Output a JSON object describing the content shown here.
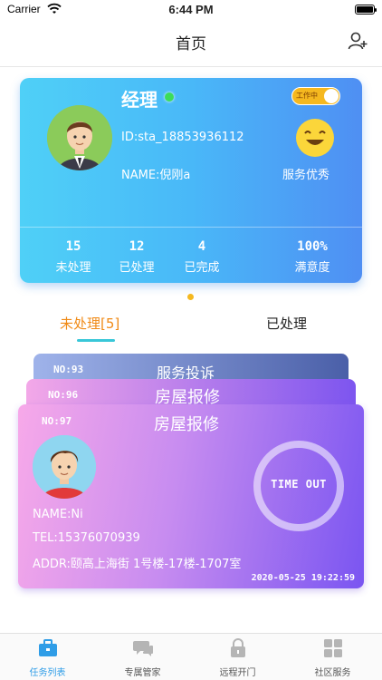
{
  "status_bar": {
    "carrier": "Carrier",
    "time": "6:44 PM"
  },
  "nav": {
    "title": "首页",
    "add_icon": "add-user-icon"
  },
  "profile": {
    "role": "经理",
    "id_text": "ID:sta_18853936112",
    "name_text": "NAME:倪刚a",
    "toggle_label": "工作中",
    "service_label": "服务优秀",
    "stats": [
      {
        "value": "15",
        "label": "未处理"
      },
      {
        "value": "12",
        "label": "已处理"
      },
      {
        "value": "4",
        "label": "已完成"
      },
      {
        "value": "100%",
        "label": "满意度"
      }
    ],
    "colors": {
      "accent": "#4fb2f7",
      "online": "#3cdc5a",
      "toggle": "#f5b81f"
    }
  },
  "tabs": {
    "pending": "未处理[5]",
    "done": "已处理"
  },
  "tasks": [
    {
      "no": "NO:93",
      "title": "服务投诉"
    },
    {
      "no": "NO:96",
      "title": "房屋报修"
    },
    {
      "no": "NO:97",
      "title": "房屋报修",
      "name": "NAME:Ni",
      "tel": "TEL:15376070939",
      "addr": "ADDR:颐高上海街 1号楼-17楼-1707室",
      "status": "TIME OUT",
      "date": "2020-05-25 19:22:59"
    }
  ],
  "tabbar": [
    {
      "label": "任务列表",
      "icon": "briefcase-icon",
      "active": true
    },
    {
      "label": "专属管家",
      "icon": "chat-icon",
      "active": false
    },
    {
      "label": "远程开门",
      "icon": "lock-icon",
      "active": false
    },
    {
      "label": "社区服务",
      "icon": "grid-icon",
      "active": false
    }
  ]
}
